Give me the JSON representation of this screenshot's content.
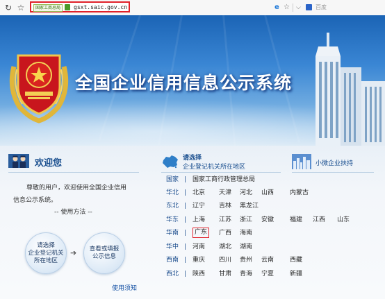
{
  "browser": {
    "back_icon": "↻",
    "star_icon": "☆",
    "site_badge": "国家工商总局",
    "url": "gsxt.saic.gov.cn",
    "ie_icon": "e",
    "star2_icon": "☆",
    "chevron_icon": "⌵",
    "search_placeholder": "百度"
  },
  "banner": {
    "title": "全国企业信用信息公示系统"
  },
  "welcome": {
    "title": "欢迎您",
    "text_line1": "尊敬的用户，欢迎使用全国企业信用",
    "text_line2": "信息公示系统。",
    "usage": "-- 使用方法 --",
    "step1": "请选择\n企业登记机关\n所在地区",
    "step2": "查看或填报\n公示信息",
    "arrow": "➔",
    "guide_link": "使用须知"
  },
  "regions": {
    "title_line1": "请选择",
    "title_line2": "企业登记机关所在地区",
    "rows": [
      {
        "label": "国家",
        "items": [
          "国家工商行政管理总局"
        ]
      },
      {
        "label": "华北",
        "items": [
          "北京",
          "天津",
          "河北",
          "山西",
          "内蒙古"
        ]
      },
      {
        "label": "东北",
        "items": [
          "辽宁",
          "吉林",
          "黑龙江"
        ]
      },
      {
        "label": "华东",
        "items": [
          "上海",
          "江苏",
          "浙江",
          "安徽",
          "福建",
          "江西",
          "山东"
        ]
      },
      {
        "label": "华南",
        "items": [
          "广东",
          "广西",
          "海南"
        ]
      },
      {
        "label": "华中",
        "items": [
          "河南",
          "湖北",
          "湖南"
        ]
      },
      {
        "label": "西南",
        "items": [
          "重庆",
          "四川",
          "贵州",
          "云南",
          "西藏"
        ]
      },
      {
        "label": "西北",
        "items": [
          "陕西",
          "甘肃",
          "青海",
          "宁夏",
          "新疆"
        ]
      }
    ],
    "separator": "|"
  },
  "micro": {
    "title": "小微企业扶持"
  },
  "colors": {
    "highlight_border": "#e1212a",
    "title_blue": "#1a4f8f",
    "banner_blue": "#1b64b5"
  }
}
